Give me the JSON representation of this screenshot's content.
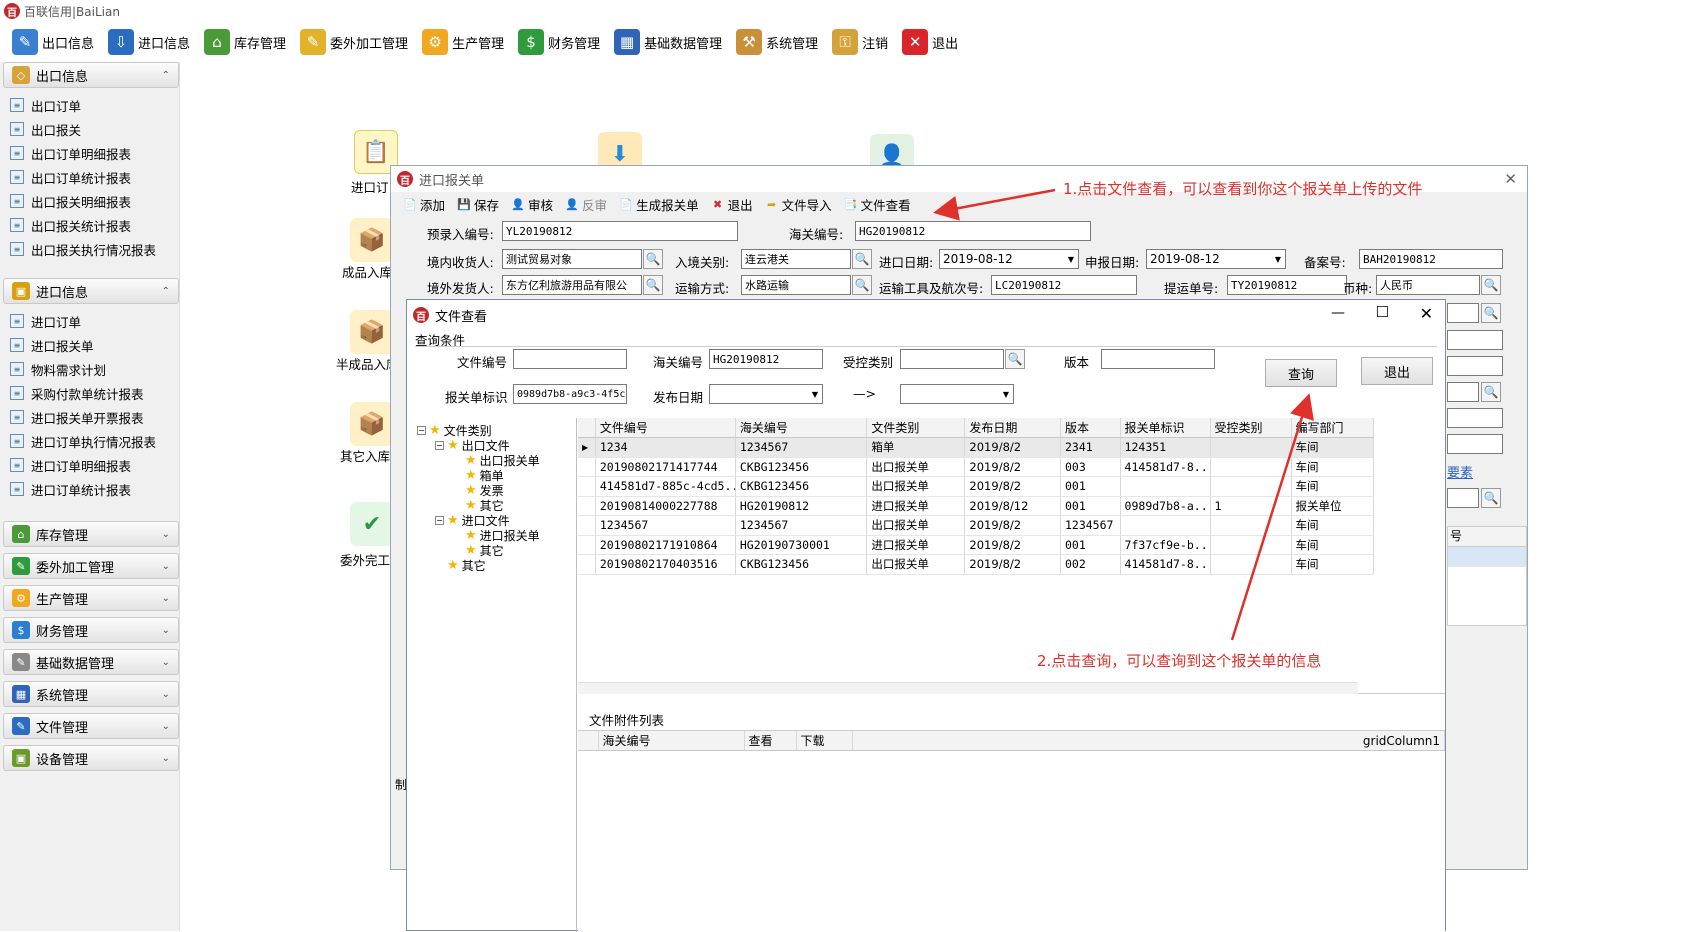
{
  "app": {
    "title": "百联信用|BaiLian",
    "logo_text": "百"
  },
  "menubar": [
    {
      "label": "出口信息",
      "icon": "edit-doc-icon",
      "color": "#3a7fd0"
    },
    {
      "label": "进口信息",
      "icon": "import-box-icon",
      "color": "#2a6cc0"
    },
    {
      "label": "库存管理",
      "icon": "house-icon",
      "color": "#4a9a3a"
    },
    {
      "label": "委外加工管理",
      "icon": "folder-pen-icon",
      "color": "#e2b32a"
    },
    {
      "label": "生产管理",
      "icon": "gear-icon",
      "color": "#f0a820"
    },
    {
      "label": "财务管理",
      "icon": "dollar-icon",
      "color": "#2f9b3c"
    },
    {
      "label": "基础数据管理",
      "icon": "table-icon",
      "color": "#3064b8"
    },
    {
      "label": "系统管理",
      "icon": "tools-icon",
      "color": "#c9903a"
    },
    {
      "label": "注销",
      "icon": "key-icon",
      "color": "#d4a23a"
    },
    {
      "label": "退出",
      "icon": "close-circle-icon",
      "color": "#d8262a"
    }
  ],
  "sidebar": {
    "export_group": {
      "label": "出口信息",
      "items": [
        "出口订单",
        "出口报关",
        "出口订单明细报表",
        "出口订单统计报表",
        "出口报关明细报表",
        "出口报关统计报表",
        "出口报关执行情况报表"
      ]
    },
    "import_group": {
      "label": "进口信息",
      "items": [
        "进口订单",
        "进口报关单",
        "物料需求计划",
        "采购付款单统计报表",
        "进口报关单开票报表",
        "进口订单执行情况报表",
        "进口订单明细报表",
        "进口订单统计报表"
      ]
    },
    "collapsed_groups": [
      "库存管理",
      "委外加工管理",
      "生产管理",
      "财务管理",
      "基础数据管理",
      "系统管理",
      "文件管理",
      "设备管理"
    ]
  },
  "flow": {
    "labels": [
      "进口订",
      "成品入库",
      "半成品入库",
      "其它入库",
      "委外完工"
    ]
  },
  "customs_window": {
    "title": "进口报关单",
    "toolbar": [
      "添加",
      "保存",
      "审核",
      "反审",
      "生成报关单",
      "退出",
      "文件导入",
      "文件查看"
    ],
    "fields": {
      "pre_entry_label": "预录入编号:",
      "pre_entry_value": "YL20190812",
      "customs_no_label": "海关编号:",
      "customs_no_value": "HG20190812",
      "consignee_label": "境内收货人:",
      "consignee_value": "测试贸易对象",
      "entry_port_label": "入境关别:",
      "entry_port_value": "连云港关",
      "import_date_label": "进口日期:",
      "import_date_value": "2019-08-12",
      "declare_date_label": "申报日期:",
      "declare_date_value": "2019-08-12",
      "record_no_label": "备案号:",
      "record_no_value": "BAH20190812",
      "shipper_label": "境外发货人:",
      "shipper_value": "东方亿利旅游用品有限公",
      "transport_label": "运输方式:",
      "transport_value": "水路运输",
      "vehicle_label": "运输工具及航次号:",
      "vehicle_value": "LC20190812",
      "bill_label": "提运单号:",
      "bill_value": "TY20190812",
      "currency_label": "币种:",
      "currency_value": "人民币"
    },
    "partial_link": "要素",
    "partial_col": "号",
    "partial_footer": "制"
  },
  "file_window": {
    "title": "文件查看",
    "section_label": "查询条件",
    "file_no_label": "文件编号",
    "file_no_value": "",
    "customs_no_label": "海关编号",
    "customs_no_value": "HG20190812",
    "control_label": "受控类别",
    "control_value": "",
    "version_label": "版本",
    "version_value": "",
    "declaration_id_label": "报关单标识",
    "declaration_id_value": "0989d7b8-a9c3-4f5c",
    "publish_date_label": "发布日期",
    "publish_date_value": "",
    "range_arrow": "—>",
    "query_button": "查询",
    "exit_button": "退出",
    "tree": {
      "root": "文件类别",
      "export": "出口文件",
      "export_children": [
        "出口报关单",
        "箱单",
        "发票",
        "其它"
      ],
      "import": "进口文件",
      "import_children": [
        "进口报关单",
        "其它"
      ],
      "other": "其它"
    },
    "grid": {
      "columns": [
        "文件编号",
        "海关编号",
        "文件类别",
        "发布日期",
        "版本",
        "报关单标识",
        "受控类别",
        "编写部门"
      ],
      "rows": [
        [
          "1234",
          "1234567",
          "箱单",
          "2019/8/2",
          "2341",
          "124351",
          "",
          "车间"
        ],
        [
          "20190802171417744",
          "CKBG123456",
          "出口报关单",
          "2019/8/2",
          "003",
          "414581d7-8...",
          "",
          "车间"
        ],
        [
          "414581d7-885c-4cd5...",
          "CKBG123456",
          "出口报关单",
          "2019/8/2",
          "001",
          "",
          "",
          "车间"
        ],
        [
          "20190814000227788",
          "HG20190812",
          "进口报关单",
          "2019/8/12",
          "001",
          "0989d7b8-a...",
          "1",
          "报关单位"
        ],
        [
          "1234567",
          "1234567",
          "出口报关单",
          "2019/8/2",
          "1234567",
          "",
          "",
          "车间"
        ],
        [
          "20190802171910864",
          "HG20190730001",
          "进口报关单",
          "2019/8/2",
          "001",
          "7f37cf9e-b...",
          "",
          "车间"
        ],
        [
          "20190802170403516",
          "CKBG123456",
          "出口报关单",
          "2019/8/2",
          "002",
          "414581d7-8...",
          "",
          "车间"
        ]
      ]
    },
    "attachments": {
      "title": "文件附件列表",
      "columns": [
        "海关编号",
        "查看",
        "下载",
        "gridColumn1"
      ]
    }
  },
  "annotations": {
    "note1": "1.点击文件查看，可以查看到你这个报关单上传的文件",
    "note2": "2.点击查询，可以查询到这个报关单的信息"
  },
  "colors": {
    "annotation": "#e0302a",
    "logo": "#c0282d"
  }
}
